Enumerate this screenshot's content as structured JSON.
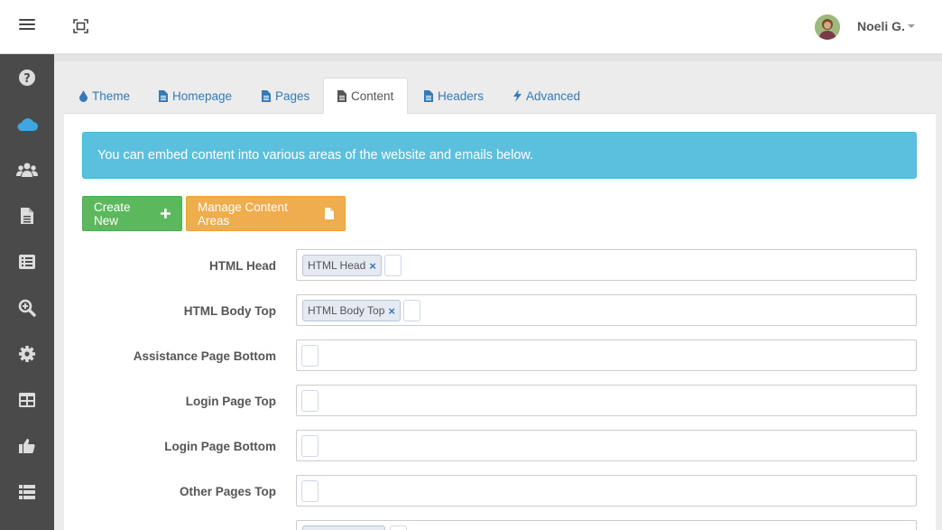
{
  "topbar": {
    "menu_icon": "hamburger-icon",
    "expand_icon": "fullscreen-icon",
    "user_name": "Noeli G."
  },
  "sidebar": {
    "items": [
      {
        "icon": "question-circle-icon",
        "active": false
      },
      {
        "icon": "cloud-icon",
        "active": true
      },
      {
        "icon": "users-icon",
        "active": false
      },
      {
        "icon": "file-icon",
        "active": false
      },
      {
        "icon": "list-alt-icon",
        "active": false
      },
      {
        "icon": "search-plus-icon",
        "active": false
      },
      {
        "icon": "gear-icon",
        "active": false
      },
      {
        "icon": "table-icon",
        "active": false
      },
      {
        "icon": "thumbs-up-icon",
        "active": false
      },
      {
        "icon": "list-icon",
        "active": false
      }
    ]
  },
  "tabs": [
    {
      "label": "Theme",
      "icon": "droplet-icon",
      "active": false
    },
    {
      "label": "Homepage",
      "icon": "file-text-icon",
      "active": false
    },
    {
      "label": "Pages",
      "icon": "file-text-icon",
      "active": false
    },
    {
      "label": "Content",
      "icon": "file-text-icon",
      "active": true
    },
    {
      "label": "Headers",
      "icon": "file-text-icon",
      "active": false
    },
    {
      "label": "Advanced",
      "icon": "bolt-icon",
      "active": false
    }
  ],
  "alert_text": "You can embed content into various areas of the website and emails below.",
  "buttons": {
    "create_new": "Create New",
    "manage_content_areas": "Manage Content Areas"
  },
  "fields": [
    {
      "label": "HTML Head",
      "tags": [
        "HTML Head"
      ]
    },
    {
      "label": "HTML Body Top",
      "tags": [
        "HTML Body Top"
      ]
    },
    {
      "label": "Assistance Page Bottom",
      "tags": []
    },
    {
      "label": "Login Page Top",
      "tags": []
    },
    {
      "label": "Login Page Bottom",
      "tags": []
    },
    {
      "label": "Other Pages Top",
      "tags": []
    }
  ],
  "tag_remove_symbol": "×",
  "colors": {
    "sidebar_bg": "#4a4a4a",
    "sidebar_active": "#3ea6e0",
    "link": "#337ab7",
    "alert_info": "#5bc0de",
    "btn_success": "#5cb85c",
    "btn_warning": "#f0ad4e"
  }
}
